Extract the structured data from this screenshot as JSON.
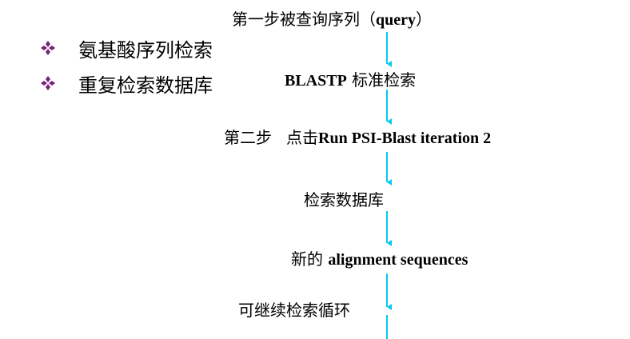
{
  "bullets": [
    {
      "text": "氨基酸序列检索"
    },
    {
      "text": "重复检索数据库"
    }
  ],
  "steps": {
    "step1": {
      "cn": "第一步被查询序列（",
      "en": "query",
      "cn_end": "）"
    },
    "step2": {
      "en": "BLASTP",
      "cn": " 标准检索"
    },
    "step3": {
      "label": "第二步",
      "cn": "点击",
      "en": "Run PSI-Blast iteration 2"
    },
    "step4": {
      "cn": "检索数据库"
    },
    "step5": {
      "cn": "新的 ",
      "en": "alignment sequences"
    },
    "step6": {
      "cn": "可继续检索循环"
    }
  },
  "colors": {
    "bullet": "#7B1F7B",
    "arrow": "#00CCEE"
  },
  "icons": {
    "bullet": "four-diamond-bullet-icon"
  }
}
